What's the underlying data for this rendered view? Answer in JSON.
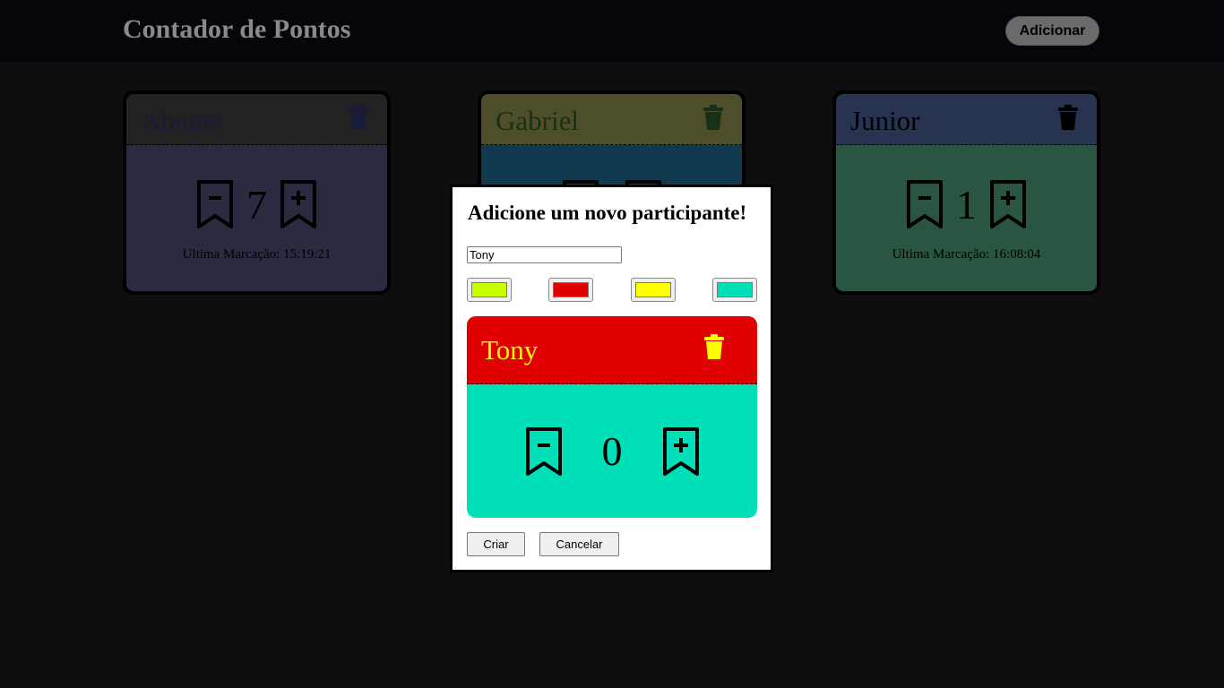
{
  "header": {
    "title": "Contador de Pontos",
    "add_label": "Adicionar"
  },
  "cards": [
    {
      "name": "Abnner",
      "score": "7",
      "last": "Ultima Marcação: 15:19:21",
      "header_color": "#222222",
      "body_color": "#2a2a40",
      "text_color": "#1a1a3a"
    },
    {
      "name": "Gabriel",
      "score": "",
      "last": "",
      "header_color": "#4e4e2a",
      "body_color": "#113a4e",
      "text_color": "#173017"
    },
    {
      "name": "Junior",
      "score": "1",
      "last": "Ultima Marcação: 16:08:04",
      "header_color": "#283350",
      "body_color": "#295542",
      "text_color": "#000000"
    }
  ],
  "modal": {
    "title": "Adicione um novo participante!",
    "name_value": "Tony",
    "swatches": [
      "#c8ff00",
      "#e00000",
      "#ffff00",
      "#00e0b8"
    ],
    "preview": {
      "name": "Tony",
      "score": "0",
      "header_color": "#e00000",
      "body_color": "#00e0b8",
      "text_color": "#ffff00"
    },
    "create_label": "Criar",
    "cancel_label": "Cancelar"
  }
}
